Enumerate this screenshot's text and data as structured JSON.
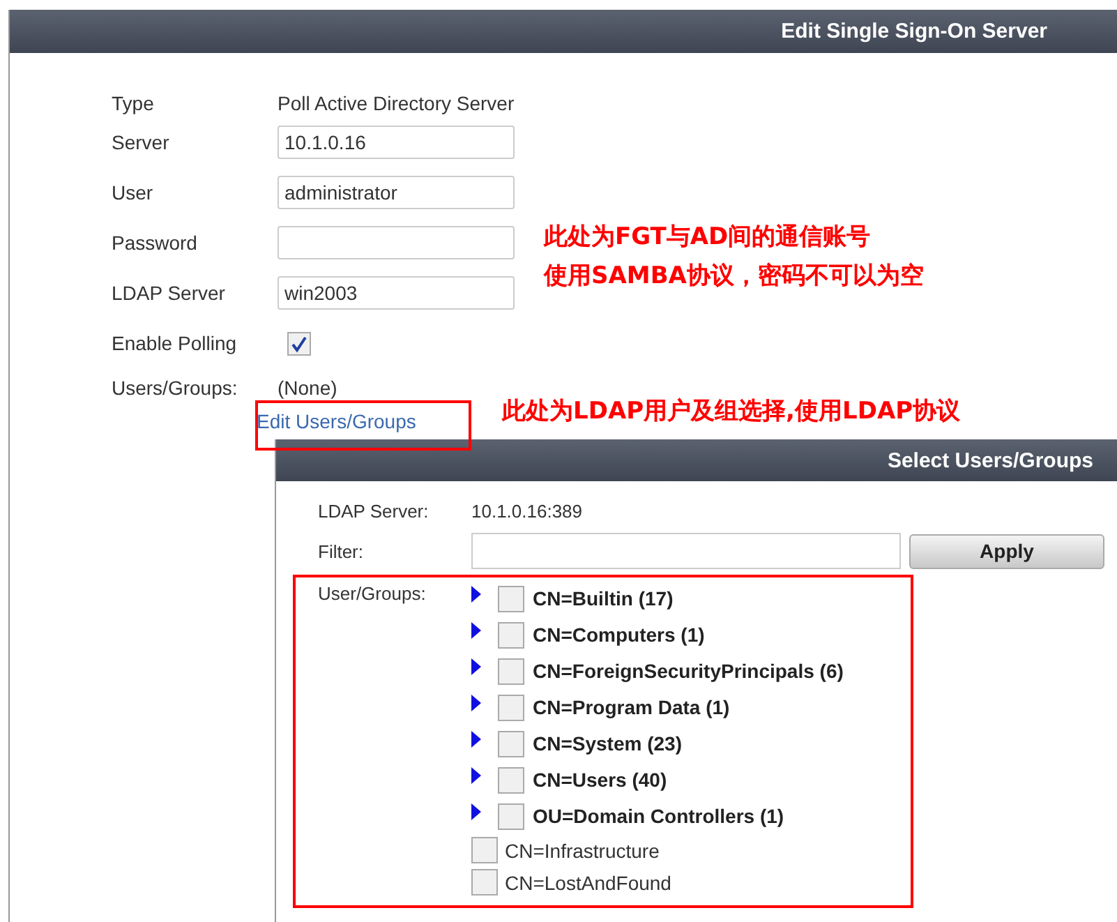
{
  "window": {
    "title": "Edit Single Sign-On Server"
  },
  "form": [
    {
      "kind": "text",
      "label": "Type",
      "value": "Poll Active Directory Server"
    },
    {
      "kind": "input",
      "label": "Server",
      "value": "10.1.0.16"
    },
    {
      "kind": "input",
      "label": "User",
      "value": "administrator"
    },
    {
      "kind": "input",
      "label": "Password"
    },
    {
      "kind": "input",
      "label": "LDAP Server",
      "value": "win2003"
    },
    {
      "kind": "checkbox",
      "label": "Enable Polling",
      "checked": true
    },
    {
      "kind": "text",
      "label": "Users/Groups:",
      "value": "(None)"
    }
  ],
  "edit_link": "Edit Users/Groups",
  "dialog": {
    "title": "Select Users/Groups",
    "ldap_label": "LDAP Server:",
    "ldap_value": "10.1.0.16:389",
    "filter_label": "Filter:",
    "apply_button": "Apply",
    "tree_label": "User/Groups:",
    "items": [
      {
        "kind": "group",
        "label": "CN=Builtin (17)",
        "checked": false
      },
      {
        "kind": "group",
        "label": "CN=Computers (1)",
        "checked": false
      },
      {
        "kind": "group",
        "label": "CN=ForeignSecurityPrincipals (6)",
        "checked": false
      },
      {
        "kind": "group",
        "label": "CN=Program Data (1)",
        "checked": false
      },
      {
        "kind": "group",
        "label": "CN=System (23)",
        "checked": false
      },
      {
        "kind": "group",
        "label": "CN=Users (40)",
        "checked": false
      },
      {
        "kind": "group",
        "label": "OU=Domain Controllers (1)",
        "checked": false
      },
      {
        "kind": "leaf",
        "label": "CN=Infrastructure",
        "checked": false
      },
      {
        "kind": "leaf",
        "label": "CN=LostAndFound",
        "checked": false
      }
    ]
  },
  "annotations": [
    {
      "lines": [
        "此处为FGT与AD间的通信账号",
        "使用SAMBA协议，密码不可以为空"
      ]
    },
    {
      "lines": [
        "此处为LDAP用户及组选择,使用LDAP协议"
      ]
    }
  ]
}
